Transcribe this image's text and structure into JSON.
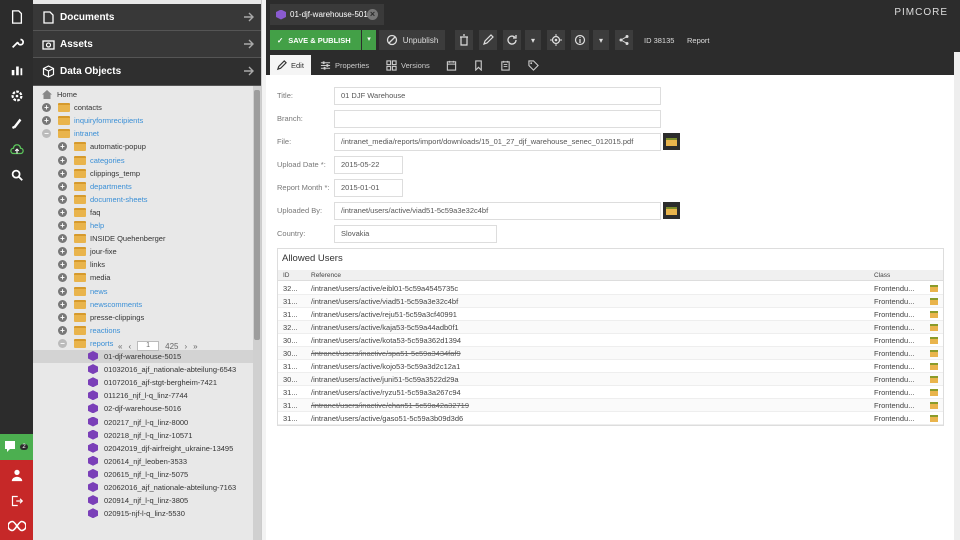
{
  "app": {
    "logo": "PIMCORE",
    "tab_title": "01-djf-warehouse-5015"
  },
  "sidebar_icons": [
    "file-icon",
    "wrench-icon",
    "chart-icon",
    "gear-icon",
    "marketing-icon",
    "cloud-icon",
    "search-icon"
  ],
  "chat_badge": "2",
  "accordion": {
    "documents": "Documents",
    "assets": "Assets",
    "data_objects": "Data Objects"
  },
  "tree": [
    {
      "label": "Home",
      "kind": "home",
      "level": 0
    },
    {
      "label": "contacts",
      "kind": "folder",
      "level": 0,
      "blue": false
    },
    {
      "label": "inquiryformrecipients",
      "kind": "folder",
      "level": 0,
      "blue": true
    },
    {
      "label": "intranet",
      "kind": "folder",
      "level": 0,
      "blue": true,
      "open": true
    },
    {
      "label": "automatic-popup",
      "kind": "folder",
      "level": 1
    },
    {
      "label": "categories",
      "kind": "folder",
      "level": 1,
      "blue": true
    },
    {
      "label": "clippings_temp",
      "kind": "folder",
      "level": 1
    },
    {
      "label": "departments",
      "kind": "folder",
      "level": 1,
      "blue": true
    },
    {
      "label": "document-sheets",
      "kind": "folder",
      "level": 1,
      "blue": true
    },
    {
      "label": "faq",
      "kind": "folder",
      "level": 1
    },
    {
      "label": "help",
      "kind": "folder",
      "level": 1,
      "blue": true
    },
    {
      "label": "INSIDE Quehenberger",
      "kind": "folder",
      "level": 1
    },
    {
      "label": "jour-fixe",
      "kind": "folder",
      "level": 1
    },
    {
      "label": "links",
      "kind": "folder",
      "level": 1
    },
    {
      "label": "media",
      "kind": "folder",
      "level": 1
    },
    {
      "label": "news",
      "kind": "folder",
      "level": 1,
      "blue": true
    },
    {
      "label": "newscomments",
      "kind": "folder",
      "level": 1,
      "blue": true
    },
    {
      "label": "presse-clippings",
      "kind": "folder",
      "level": 1
    },
    {
      "label": "reactions",
      "kind": "folder",
      "level": 1,
      "blue": true
    },
    {
      "label": "reports",
      "kind": "folder",
      "level": 1,
      "blue": true,
      "open": true
    },
    {
      "label": "01-djf-warehouse-5015",
      "kind": "object",
      "level": 2,
      "selected": true
    },
    {
      "label": "01032016_ajf_nationale-abteilung-6543",
      "kind": "object",
      "level": 2
    },
    {
      "label": "01072016_ajf-stgt-bergheim-7421",
      "kind": "object",
      "level": 2
    },
    {
      "label": "011216_njf_l-q_linz-7744",
      "kind": "object",
      "level": 2
    },
    {
      "label": "02-djf-warehouse-5016",
      "kind": "object",
      "level": 2
    },
    {
      "label": "020217_njf_l-q_linz-8000",
      "kind": "object",
      "level": 2
    },
    {
      "label": "020218_njf_l-q_linz-10571",
      "kind": "object",
      "level": 2
    },
    {
      "label": "02042019_djf-airfreight_ukraine-13495",
      "kind": "object",
      "level": 2
    },
    {
      "label": "020614_njf_leoben-3533",
      "kind": "object",
      "level": 2
    },
    {
      "label": "020615_njf_l-q_linz-5075",
      "kind": "object",
      "level": 2
    },
    {
      "label": "02062016_ajf_nationale-abteilung-7163",
      "kind": "object",
      "level": 2
    },
    {
      "label": "020914_njf_l-q_linz-3805",
      "kind": "object",
      "level": 2
    },
    {
      "label": "020915-njf-l-q_linz-5530",
      "kind": "object",
      "level": 2
    }
  ],
  "pager": {
    "page": "1",
    "total": "425"
  },
  "toolbar": {
    "save_publish": "SAVE & PUBLISH",
    "unpublish": "Unpublish",
    "id_text": "ID 38135",
    "type_text": "Report"
  },
  "subtabs": {
    "edit": "Edit",
    "properties": "Properties",
    "versions": "Versions"
  },
  "form": {
    "title_label": "Title:",
    "title_value": "01 DJF Warehouse",
    "branch_label": "Branch:",
    "branch_value": "",
    "file_label": "File:",
    "file_value": "/intranet_media/reports/import/downloads/15_01_27_djf_warehouse_senec_012015.pdf",
    "upload_date_label": "Upload Date *:",
    "upload_date_value": "2015-05-22",
    "report_month_label": "Report Month *:",
    "report_month_value": "2015-01-01",
    "uploaded_by_label": "Uploaded By:",
    "uploaded_by_value": "/intranet/users/active/viad51-5c59a3e32c4bf",
    "country_label": "Country:",
    "country_value": "Slovakia"
  },
  "allowed_users": {
    "title": "Allowed Users",
    "columns": [
      "ID",
      "Reference",
      "Class"
    ],
    "rows": [
      {
        "id": "32...",
        "ref": "/intranet/users/active/eibl01-5c59a4545735c",
        "cls": "Frontendu...",
        "strike": false
      },
      {
        "id": "31...",
        "ref": "/intranet/users/active/viad51-5c59a3e32c4bf",
        "cls": "Frontendu...",
        "strike": false
      },
      {
        "id": "31...",
        "ref": "/intranet/users/active/reju51-5c59a3cf40991",
        "cls": "Frontendu...",
        "strike": false
      },
      {
        "id": "32...",
        "ref": "/intranet/users/active/kaja53-5c59a44adb0f1",
        "cls": "Frontendu...",
        "strike": false
      },
      {
        "id": "30...",
        "ref": "/intranet/users/active/kota53-5c59a362d1394",
        "cls": "Frontendu...",
        "strike": false
      },
      {
        "id": "30...",
        "ref": "/intranet/users/inactive/spa51-5c59a3434faf9",
        "cls": "Frontendu...",
        "strike": true
      },
      {
        "id": "31...",
        "ref": "/intranet/users/active/kojo53-5c59a3d2c12a1",
        "cls": "Frontendu...",
        "strike": false
      },
      {
        "id": "30...",
        "ref": "/intranet/users/active/juni51-5c59a3522d29a",
        "cls": "Frontendu...",
        "strike": false
      },
      {
        "id": "31...",
        "ref": "/intranet/users/active/ryzu51-5c59a3a267c94",
        "cls": "Frontendu...",
        "strike": false
      },
      {
        "id": "31...",
        "ref": "/intranet/users/inactive/chan51-5c59a42a32719",
        "cls": "Frontendu...",
        "strike": true
      },
      {
        "id": "31...",
        "ref": "/intranet/users/active/gaso51-5c59a3b09d3d6",
        "cls": "Frontendu...",
        "strike": false
      }
    ]
  }
}
